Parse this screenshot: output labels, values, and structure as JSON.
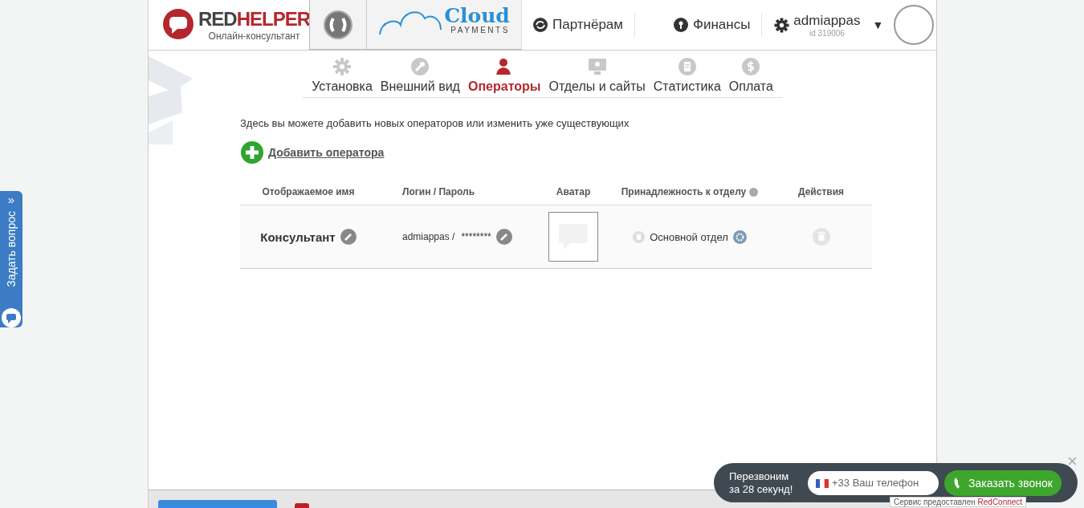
{
  "header": {
    "logo": {
      "brand_dark": "RED",
      "brand_red": "HELPER",
      "tagline": "Онлайн-консультант"
    },
    "cloud": {
      "name": "Cloud",
      "sub": "PAYMENTS"
    },
    "links": [
      {
        "label": "Партнёрам",
        "kind": "partners"
      },
      {
        "label": "Финансы",
        "kind": "finance"
      }
    ],
    "user": {
      "name": "admiappas",
      "id": "id 319006",
      "caret": "▼"
    }
  },
  "tabs": [
    {
      "label": "Установка",
      "selected": false
    },
    {
      "label": "Внешний вид",
      "selected": false
    },
    {
      "label": "Операторы",
      "selected": true
    },
    {
      "label": "Отделы и сайты",
      "selected": false
    },
    {
      "label": "Статистика",
      "selected": false
    },
    {
      "label": "Оплата",
      "selected": false
    }
  ],
  "intro": "Здесь вы можете добавить новых операторов или изменить уже существующих",
  "add_link": "Добавить оператора",
  "table": {
    "columns": [
      "Отображаемое имя",
      "Логин / Пароль",
      "Аватар",
      "Принадлежность к отделу",
      "Действия"
    ],
    "rows": [
      {
        "name": "Консультант",
        "login": "admiappas /",
        "password": "********",
        "department": "Основной отдел"
      }
    ]
  },
  "feedback_tab": {
    "label": "Задать вопрос",
    "chevron": "»"
  },
  "callback": {
    "line1": "Перезвоним",
    "line2": "за 28 секунд!",
    "placeholder": "+33 Ваш телефон",
    "button": "Заказать звонок",
    "close": "×",
    "credit": "Сервис предоставлен",
    "credit_brand": "RedConnect"
  }
}
